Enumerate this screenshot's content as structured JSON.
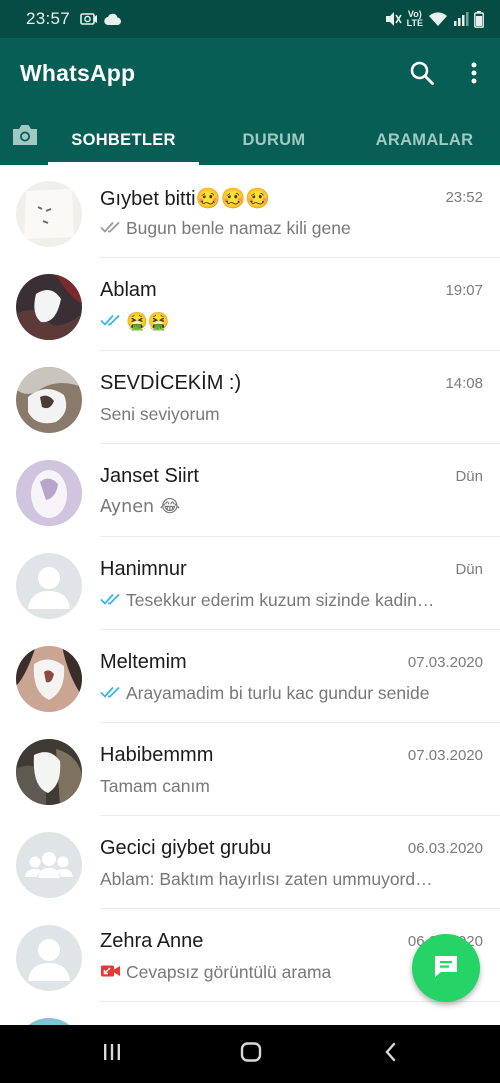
{
  "status_bar": {
    "time": "23:57",
    "lte_label": "VoLTE"
  },
  "app_bar": {
    "title": "WhatsApp",
    "icons": [
      "search-icon",
      "more-vert-icon"
    ]
  },
  "tabs": {
    "camera_icon": "camera-icon",
    "items": [
      {
        "label": "SOHBETLER",
        "active": true
      },
      {
        "label": "DURUM",
        "active": false
      },
      {
        "label": "ARAMALAR",
        "active": false
      }
    ]
  },
  "chats": [
    {
      "name": "Gıybet bitti",
      "name_emoji": "🥴🥴🥴",
      "time": "23:52",
      "tick": "grey",
      "preview": "Bugun benle namaz kili gene",
      "avatar": "photo-light"
    },
    {
      "name": "Ablam",
      "name_emoji": "",
      "time": "19:07",
      "tick": "blue",
      "preview": "🤮🤮",
      "avatar": "photo-dark"
    },
    {
      "name": "SEVDİCEKİM :)",
      "name_emoji": "",
      "time": "14:08",
      "tick": "none",
      "preview": "Seni seviyorum",
      "avatar": "photo-couple"
    },
    {
      "name": "Janset Siirt",
      "name_emoji": "",
      "time": "Dün",
      "tick": "none",
      "preview": "Aynen 😂",
      "avatar": "photo-lilac"
    },
    {
      "name": "Hanimnur",
      "name_emoji": "",
      "time": "Dün",
      "tick": "blue",
      "preview": "Tesekkur ederim kuzum sizinde kadin…",
      "avatar": "default-person"
    },
    {
      "name": "Meltemim",
      "name_emoji": "",
      "time": "07.03.2020",
      "tick": "blue",
      "preview": "Arayamadim bi turlu kac gundur senide",
      "avatar": "photo-warm"
    },
    {
      "name": "Habibemmm",
      "name_emoji": "",
      "time": "07.03.2020",
      "tick": "none",
      "preview": "Tamam canım",
      "avatar": "photo-dark2"
    },
    {
      "name": "Gecici giybet grubu",
      "name_emoji": "",
      "time": "06.03.2020",
      "tick": "none",
      "preview": "Ablam: Baktım hayırlısı zaten ummuyord…",
      "avatar": "default-group"
    },
    {
      "name": "Zehra Anne",
      "name_emoji": "",
      "time": "06.03.2020",
      "tick": "missed-video",
      "preview": "Cevapsız görüntülü arama",
      "avatar": "default-person"
    }
  ],
  "fab": {
    "icon": "new-chat-icon"
  },
  "nav_bar": {
    "icons": [
      "recent-apps-icon",
      "home-icon",
      "back-icon"
    ]
  },
  "colors": {
    "header": "#075e54",
    "status_bar": "#054d44",
    "fab": "#25d366",
    "read_tick": "#34b7f1",
    "missed_call": "#e53935"
  }
}
